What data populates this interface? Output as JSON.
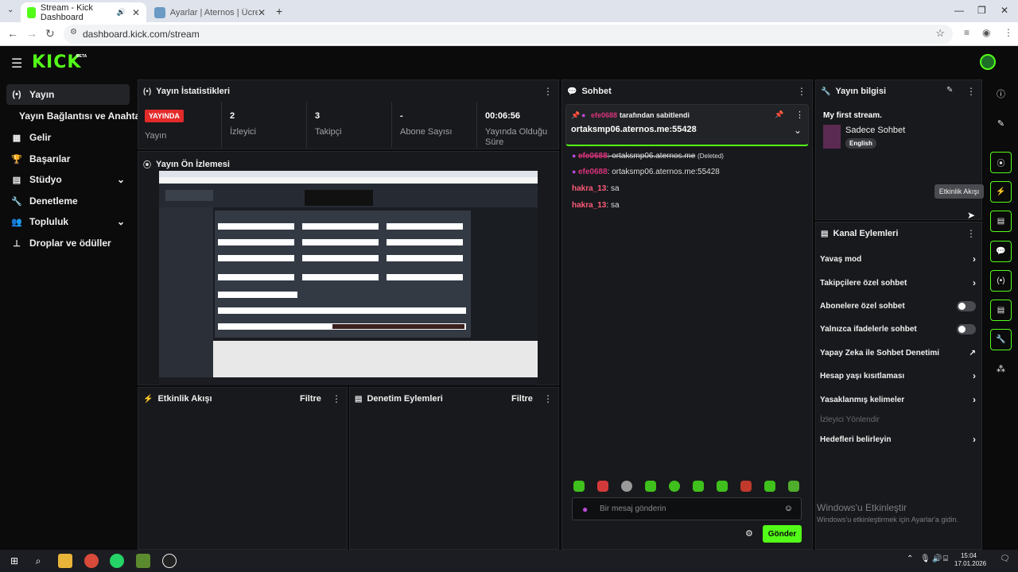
{
  "browser": {
    "tabs": [
      {
        "title": "Stream - Kick Dashboard",
        "active": true
      },
      {
        "title": "Ayarlar | Aternos | Ücretsiz Mine",
        "active": false
      }
    ],
    "url": "dashboard.kick.com/stream"
  },
  "app": {
    "logo": "KICK",
    "beta": "BETA"
  },
  "sidebar": {
    "items": [
      {
        "label": "Yayın",
        "icon": "broadcast-icon",
        "active": true
      },
      {
        "label": "Yayın Bağlantısı ve Anahtarı",
        "icon": "",
        "active": false
      },
      {
        "label": "Gelir",
        "icon": "revenue-icon",
        "active": false
      },
      {
        "label": "Başarılar",
        "icon": "trophy-icon",
        "active": false
      },
      {
        "label": "Stüdyo",
        "icon": "studio-icon",
        "active": false,
        "expandable": true
      },
      {
        "label": "Denetleme",
        "icon": "wrench-icon",
        "active": false
      },
      {
        "label": "Topluluk",
        "icon": "community-icon",
        "active": false,
        "expandable": true
      },
      {
        "label": "Droplar ve ödüller",
        "icon": "drops-icon",
        "active": false
      }
    ]
  },
  "stats": {
    "title": "Yayın İstatistikleri",
    "live_badge": "YAYINDA",
    "live_label": "Yayın",
    "items": [
      {
        "value": "2",
        "label": "İzleyici"
      },
      {
        "value": "3",
        "label": "Takipçi"
      },
      {
        "value": "-",
        "label": "Abone Sayısı"
      },
      {
        "value": "00:06:56",
        "label": "Yayında Olduğu Süre"
      }
    ]
  },
  "preview": {
    "title": "Yayın Ön İzlemesi"
  },
  "activity": {
    "title": "Etkinlik Akışı",
    "filter": "Filtre"
  },
  "moderation": {
    "title": "Denetim Eylemleri",
    "filter": "Filtre"
  },
  "chat": {
    "title": "Sohbet",
    "pinned_by_user": "efe0688",
    "pinned_by_text": "tarafından sabitlendi",
    "pinned_message": "ortaksmp06.aternos.me:55428",
    "messages": [
      {
        "user": "efe0688",
        "text": "ortaksmp06.aternos.me",
        "note": "(Deleted)",
        "deleted": true,
        "color": "#d8347a"
      },
      {
        "user": "efe0688",
        "text": "ortaksmp06.aternos.me:55428",
        "deleted": false,
        "color": "#d8347a"
      },
      {
        "user": "hakra_13",
        "text": "sa",
        "deleted": false,
        "color": "#ff5a7a"
      },
      {
        "user": "hakra_13",
        "text": "sa",
        "deleted": false,
        "color": "#ff5a7a"
      }
    ],
    "input_placeholder": "Bir mesaj gönderin",
    "send_label": "Gönder"
  },
  "stream_info": {
    "title": "Yayın bilgisi",
    "stream_title": "My first stream.",
    "category": "Sadece Sohbet",
    "language": "English"
  },
  "channel_actions": {
    "title": "Kanal Eylemleri",
    "items": [
      {
        "label": "Yavaş mod",
        "control": "chevron"
      },
      {
        "label": "Takipçilere özel sohbet",
        "control": "chevron"
      },
      {
        "label": "Abonelere özel sohbet",
        "control": "toggle"
      },
      {
        "label": "Yalnızca ifadelerle sohbet",
        "control": "toggle"
      },
      {
        "label": "Yapay Zeka ile Sohbet Denetimi",
        "control": "external"
      },
      {
        "label": "Hesap yaşı kısıtlaması",
        "control": "chevron"
      },
      {
        "label": "Yasaklanmış kelimeler",
        "control": "chevron"
      },
      {
        "label": "İzleyici Yönlendir",
        "control": "none",
        "disabled": true
      },
      {
        "label": "Hedefleri belirleyin",
        "control": "chevron"
      }
    ]
  },
  "rail": {
    "tooltip": "Etkinlik Akışı"
  },
  "watermark": {
    "line1": "Windows'u Etkinleştir",
    "line2": "Windows'u etkinleştirmek için Ayarlar'a gidin."
  },
  "taskbar": {
    "time": "15:04",
    "date": "17.01.2026"
  },
  "colors": {
    "accent": "#53fc18",
    "live": "#e32b2b",
    "panel": "#18191c"
  }
}
